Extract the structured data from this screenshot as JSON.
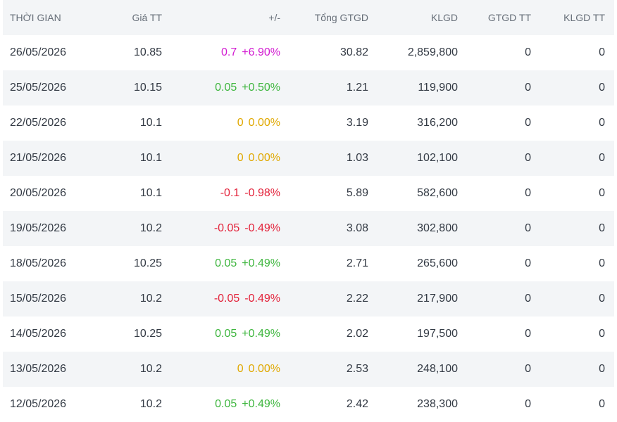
{
  "colors": {
    "up": "#3fb63f",
    "down": "#e3223a",
    "ref": "#e0a800",
    "ceil": "#d21bd1",
    "header_bg": "#f3f5f7",
    "text": "#333a44",
    "header_text": "#666e78"
  },
  "table": {
    "headers": {
      "date": "THỜI GIAN",
      "price": "Giá TT",
      "change": "+/-",
      "total_value": "Tổng GTGD",
      "volume": "KLGD",
      "gtgd_tt": "GTGD TT",
      "klgd_tt": "KLGD TT"
    },
    "rows": [
      {
        "date": "26/05/2026",
        "price": "10.85",
        "change": "0.7",
        "change_pct": "+6.90%",
        "status": "ceil",
        "total_value": "30.82",
        "volume": "2,859,800",
        "gtgd_tt": "0",
        "klgd_tt": "0"
      },
      {
        "date": "25/05/2026",
        "price": "10.15",
        "change": "0.05",
        "change_pct": "+0.50%",
        "status": "up",
        "total_value": "1.21",
        "volume": "119,900",
        "gtgd_tt": "0",
        "klgd_tt": "0"
      },
      {
        "date": "22/05/2026",
        "price": "10.1",
        "change": "0",
        "change_pct": "0.00%",
        "status": "ref",
        "total_value": "3.19",
        "volume": "316,200",
        "gtgd_tt": "0",
        "klgd_tt": "0"
      },
      {
        "date": "21/05/2026",
        "price": "10.1",
        "change": "0",
        "change_pct": "0.00%",
        "status": "ref",
        "total_value": "1.03",
        "volume": "102,100",
        "gtgd_tt": "0",
        "klgd_tt": "0"
      },
      {
        "date": "20/05/2026",
        "price": "10.1",
        "change": "-0.1",
        "change_pct": "-0.98%",
        "status": "down",
        "total_value": "5.89",
        "volume": "582,600",
        "gtgd_tt": "0",
        "klgd_tt": "0"
      },
      {
        "date": "19/05/2026",
        "price": "10.2",
        "change": "-0.05",
        "change_pct": "-0.49%",
        "status": "down",
        "total_value": "3.08",
        "volume": "302,800",
        "gtgd_tt": "0",
        "klgd_tt": "0"
      },
      {
        "date": "18/05/2026",
        "price": "10.25",
        "change": "0.05",
        "change_pct": "+0.49%",
        "status": "up",
        "total_value": "2.71",
        "volume": "265,600",
        "gtgd_tt": "0",
        "klgd_tt": "0"
      },
      {
        "date": "15/05/2026",
        "price": "10.2",
        "change": "-0.05",
        "change_pct": "-0.49%",
        "status": "down",
        "total_value": "2.22",
        "volume": "217,900",
        "gtgd_tt": "0",
        "klgd_tt": "0"
      },
      {
        "date": "14/05/2026",
        "price": "10.25",
        "change": "0.05",
        "change_pct": "+0.49%",
        "status": "up",
        "total_value": "2.02",
        "volume": "197,500",
        "gtgd_tt": "0",
        "klgd_tt": "0"
      },
      {
        "date": "13/05/2026",
        "price": "10.2",
        "change": "0",
        "change_pct": "0.00%",
        "status": "ref",
        "total_value": "2.53",
        "volume": "248,100",
        "gtgd_tt": "0",
        "klgd_tt": "0"
      },
      {
        "date": "12/05/2026",
        "price": "10.2",
        "change": "0.05",
        "change_pct": "+0.49%",
        "status": "up",
        "total_value": "2.42",
        "volume": "238,300",
        "gtgd_tt": "0",
        "klgd_tt": "0"
      }
    ]
  }
}
